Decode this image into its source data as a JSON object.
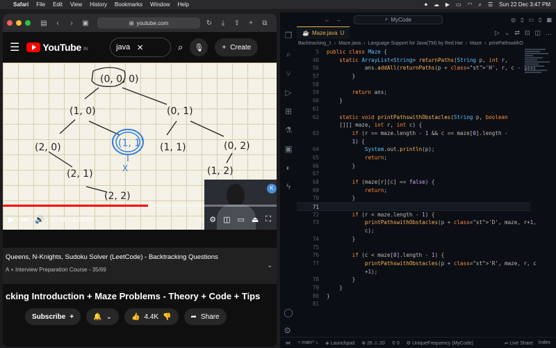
{
  "menubar": {
    "app": "Safari",
    "items": [
      "File",
      "Edit",
      "View",
      "History",
      "Bookmarks",
      "Window",
      "Help"
    ],
    "datetime": "Sun 22 Dec  3:47 PM"
  },
  "safari": {
    "url": "youtube.com"
  },
  "youtube": {
    "logo_text": "YouTube",
    "country": "IN",
    "search_value": "java",
    "create_label": "Create",
    "player": {
      "time": "47:56 / 1:28:09",
      "progress_fraction": 0.53
    },
    "up_next_partial": "Queens, N-Knights, Sudoku Solver (LeetCode) - Backtracking Questions",
    "playlist_subtitle": "A + Interview Preparation Course - 35/69",
    "video_title": "cking Introduction + Maze Problems - Theory + Code + Tips",
    "subscribe_label": "Subscribe",
    "like_count": "4.4K",
    "share_label": "Share",
    "whiteboard": {
      "root": "(0, 0, 0)",
      "n1": "(1, 0)",
      "n2": "(0, 1)",
      "n3": "(2, 0)",
      "n4": "(1, 1)",
      "n5": "(1, 1)",
      "n6": "(0, 2)",
      "n7": "(2, 1)",
      "n8": "(1, 2)",
      "n9": "(2, 2)",
      "mark": "X"
    }
  },
  "vscode": {
    "command_center": "MyCode",
    "tab_name": "Maze.java",
    "tab_status": "U",
    "breadcrumb": [
      "Backtracking_1",
      "Maze.java",
      "Language Support for Java(TM) by Red Hat",
      "Maze",
      "printPathswithO"
    ],
    "lines": [
      {
        "n": "5",
        "code": "public class Maze {"
      },
      {
        "n": "40",
        "code": "    static ArrayList<String> returnPaths(String p, int r,"
      },
      {
        "n": "56",
        "code": "            ans.addAll(returnPaths(p + 'H', r, c - 1));"
      },
      {
        "n": "57",
        "code": "        }"
      },
      {
        "n": "58",
        "code": ""
      },
      {
        "n": "59",
        "code": "        return ans;"
      },
      {
        "n": "60",
        "code": "    }"
      },
      {
        "n": "61",
        "code": ""
      },
      {
        "n": "62",
        "code": "    static void printPathswithObstacles(String p, boolean"
      },
      {
        "n": "",
        "code": "    [][] maze, int r, int c) {"
      },
      {
        "n": "63",
        "code": "        if (r == maze.length - 1 && c == maze[0].length -"
      },
      {
        "n": "",
        "code": "        1) {"
      },
      {
        "n": "64",
        "code": "            System.out.println(p);"
      },
      {
        "n": "65",
        "code": "            return;"
      },
      {
        "n": "66",
        "code": "        }"
      },
      {
        "n": "67",
        "code": ""
      },
      {
        "n": "68",
        "code": "        if (maze[r][c] == false) {"
      },
      {
        "n": "69",
        "code": "            return;"
      },
      {
        "n": "70",
        "code": "        }"
      },
      {
        "n": "71",
        "code": ""
      },
      {
        "n": "72",
        "code": "        if (r < maze.length - 1) {"
      },
      {
        "n": "73",
        "code": "            printPathswithObstacles(p + 'D', maze, r+1,"
      },
      {
        "n": "",
        "code": "            c);"
      },
      {
        "n": "74",
        "code": "        }"
      },
      {
        "n": "75",
        "code": ""
      },
      {
        "n": "76",
        "code": "        if (c < maze[0].length - 1) {"
      },
      {
        "n": "77",
        "code": "            printPathswithObstacles(p + 'R', maze, r, c"
      },
      {
        "n": "",
        "code": "            +1);"
      },
      {
        "n": "78",
        "code": "        }"
      },
      {
        "n": "79",
        "code": "    }"
      },
      {
        "n": "80",
        "code": "}"
      },
      {
        "n": "81",
        "code": ""
      }
    ],
    "active_line": "71",
    "status": {
      "branch": "main*",
      "launchpad": "Launchpad",
      "errors": "26",
      "warnings": "20",
      "ports": "0",
      "run_config": "UniqueFrequency (MyCode)",
      "live_share": "Live Share",
      "index": "Index"
    }
  },
  "colors": {
    "yt_red": "#ff0000",
    "vscode_accent": "#e6b450",
    "keyword": "#ff8f40",
    "type": "#59c2ff",
    "function": "#ffb454",
    "string": "#aad94c",
    "number": "#d2a6ff"
  }
}
